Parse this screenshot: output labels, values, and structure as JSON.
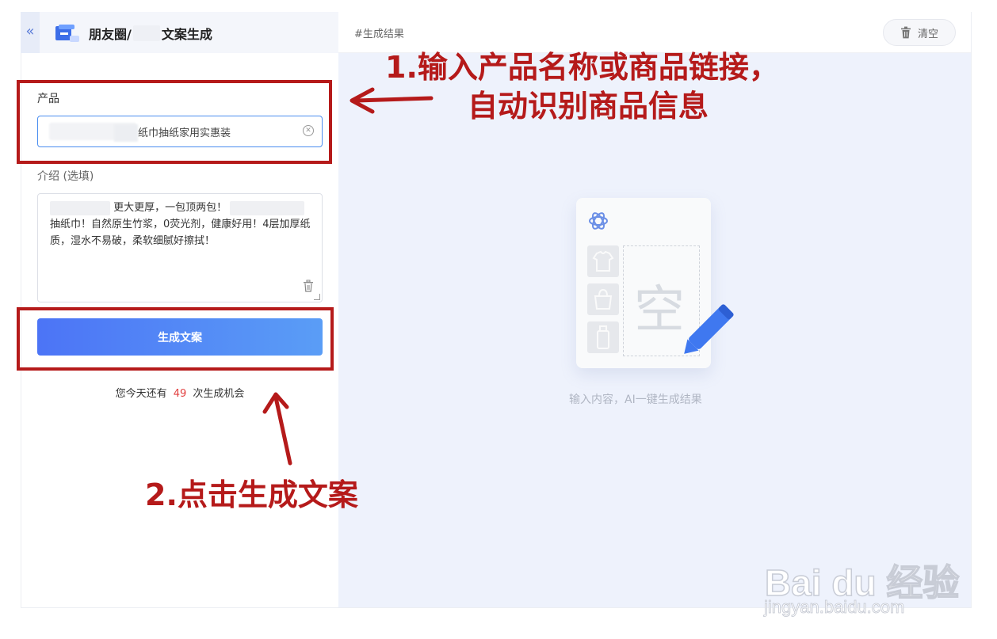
{
  "app": {
    "collapse_icon": "«",
    "title_prefix": "朋友圈/",
    "title_suffix": "文案生成"
  },
  "form": {
    "product_label": "产品",
    "product_value": "纸巾抽纸家用实惠装",
    "intro_label": "介绍 (选填)",
    "intro_line1": "更大更厚，一包顶两包！",
    "intro_line2": "抽纸巾！自然原生竹浆，0荧光剂，健康好用！4层加厚纸质，湿水不易破，柔软细腻好擦拭！",
    "generate_label": "生成文案",
    "quota_prefix": "您今天还有",
    "quota_count": "49",
    "quota_suffix": "次生成机会"
  },
  "result": {
    "label": "#生成结果",
    "clear_label": "清空",
    "empty_char": "空",
    "empty_hint": "输入内容，AI一键生成结果"
  },
  "annotations": {
    "step1_line1": "1.输入产品名称或商品链接，",
    "step1_line2": "自动识别商品信息",
    "step2": "2.点击生成文案"
  },
  "watermark": {
    "logo": "Bai du 经验",
    "url": "jingyan.baidu.com"
  },
  "colors": {
    "accent": "#4c74f6",
    "annotation": "#b51a1a",
    "result_bg": "#eef2fc",
    "quota_highlight": "#e24040"
  },
  "icons": {
    "collapse": "double-chevron-left-icon",
    "clear": "trash-icon",
    "input_clear": "circle-x-icon",
    "empty_ai": "openai-logo-icon",
    "pencil": "pencil-icon"
  }
}
